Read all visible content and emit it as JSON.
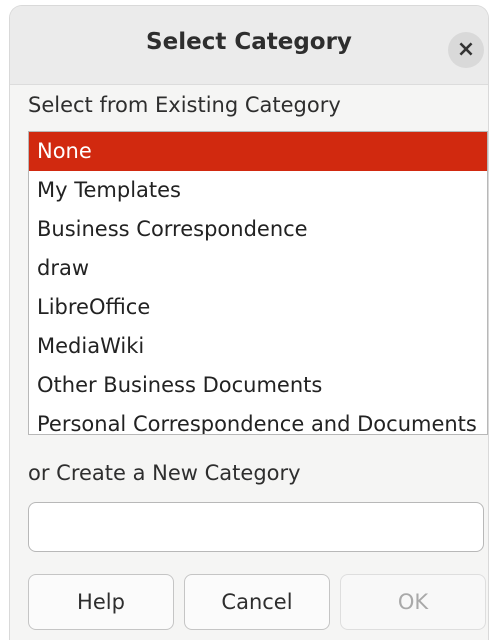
{
  "dialog": {
    "title": "Select Category",
    "close_icon": "close-icon",
    "close_glyph": "×"
  },
  "existing": {
    "label": "Select from Existing Category",
    "selected_index": 0,
    "items": [
      "None",
      "My Templates",
      "Business Correspondence",
      "draw",
      "LibreOffice",
      "MediaWiki",
      "Other Business Documents",
      "Personal Correspondence and Documents"
    ]
  },
  "new_category": {
    "label": "or Create a New Category",
    "value": ""
  },
  "buttons": {
    "help": "Help",
    "cancel": "Cancel",
    "ok": "OK"
  },
  "colors": {
    "selection": "#d1290f",
    "dialog_bg": "#f5f5f4"
  }
}
